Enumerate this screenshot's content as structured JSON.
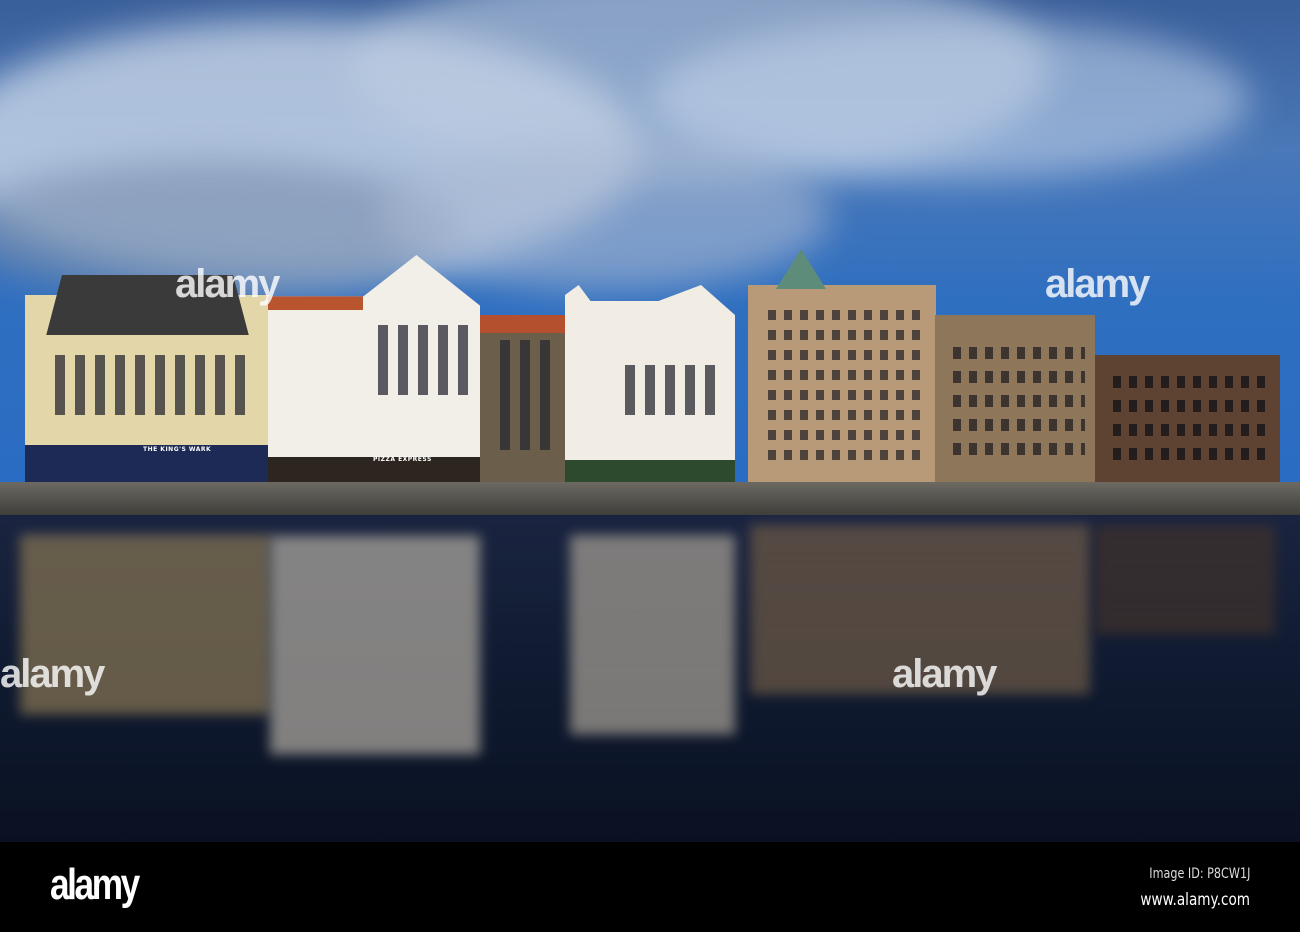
{
  "photo": {
    "signs": {
      "kings_wark": "THE KING'S WARK",
      "pizza_express": "PIZZA EXPRESS"
    },
    "watermark": "alamy",
    "colors": {
      "sky": "#2f6fc0",
      "water": "#0f1a30",
      "white_facade": "#f2efe8",
      "sandstone": "#b89a78"
    }
  },
  "footer": {
    "logo": "alamy",
    "image_id": "Image ID: P8CW1J",
    "website": "www.alamy.com"
  }
}
